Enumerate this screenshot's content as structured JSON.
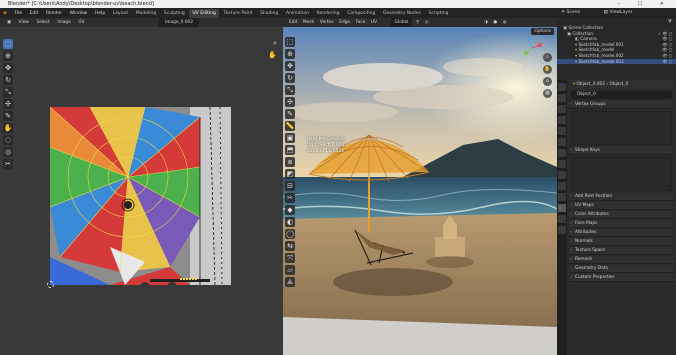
{
  "window": {
    "title": "Blender* [C:\\Users\\Andy\\Desktop\\blender-uv\\beach.blend]",
    "controls": "–  ☐  ✕"
  },
  "menu": {
    "items": [
      "File",
      "Edit",
      "Render",
      "Window",
      "Help"
    ],
    "workspaces": [
      "Layout",
      "Modeling",
      "Sculpting",
      "UV Editing",
      "Texture Paint",
      "Shading",
      "Animation",
      "Rendering",
      "Compositing",
      "Geometry Nodes",
      "Scripting"
    ],
    "active_workspace": "UV Editing"
  },
  "right_header": {
    "scene_label": "Scene",
    "viewlayer_label": "ViewLayer"
  },
  "uv_editor": {
    "header_items": [
      "View",
      "Select",
      "Image",
      "UV"
    ],
    "image_name": "Image_0.002"
  },
  "viewport": {
    "header_items": [
      "Edit",
      "Mesh",
      "Vertex",
      "Edge",
      "Face",
      "UV"
    ],
    "orientation": "Global",
    "options_label": "Options",
    "info_lines": [
      "User Perspective",
      "(0) Object_0.002",
      "Sample 11/1024"
    ]
  },
  "outliner": {
    "rows": [
      {
        "label": "Scene Collection",
        "indent": 0,
        "selected": false
      },
      {
        "label": "Collection",
        "indent": 1,
        "selected": false
      },
      {
        "label": "Camera",
        "indent": 2,
        "selected": false
      },
      {
        "label": "Sketchfab_model.001",
        "indent": 2,
        "selected": false
      },
      {
        "label": "Sketchfab_model",
        "indent": 2,
        "selected": false
      },
      {
        "label": "Sketchfab_model.002",
        "indent": 2,
        "selected": false
      },
      {
        "label": "Sketchfab_model.003",
        "indent": 2,
        "selected": true
      }
    ]
  },
  "properties": {
    "breadcrumb_object": "Object_0.002",
    "breadcrumb_mesh": "Object_0",
    "data_name": "Object_0",
    "sections": [
      "Vertex Groups",
      "Shape Keys",
      "UV Maps",
      "Color Attributes",
      "Face Maps",
      "Attributes",
      "Normals",
      "Texture Space",
      "Remesh",
      "Geometry Data",
      "Custom Properties"
    ],
    "panel_title": "Add Rest Position"
  },
  "colors": {
    "accent": "#4772b3",
    "canopy": "#e8a030",
    "uv_selection": "#f0e040"
  }
}
